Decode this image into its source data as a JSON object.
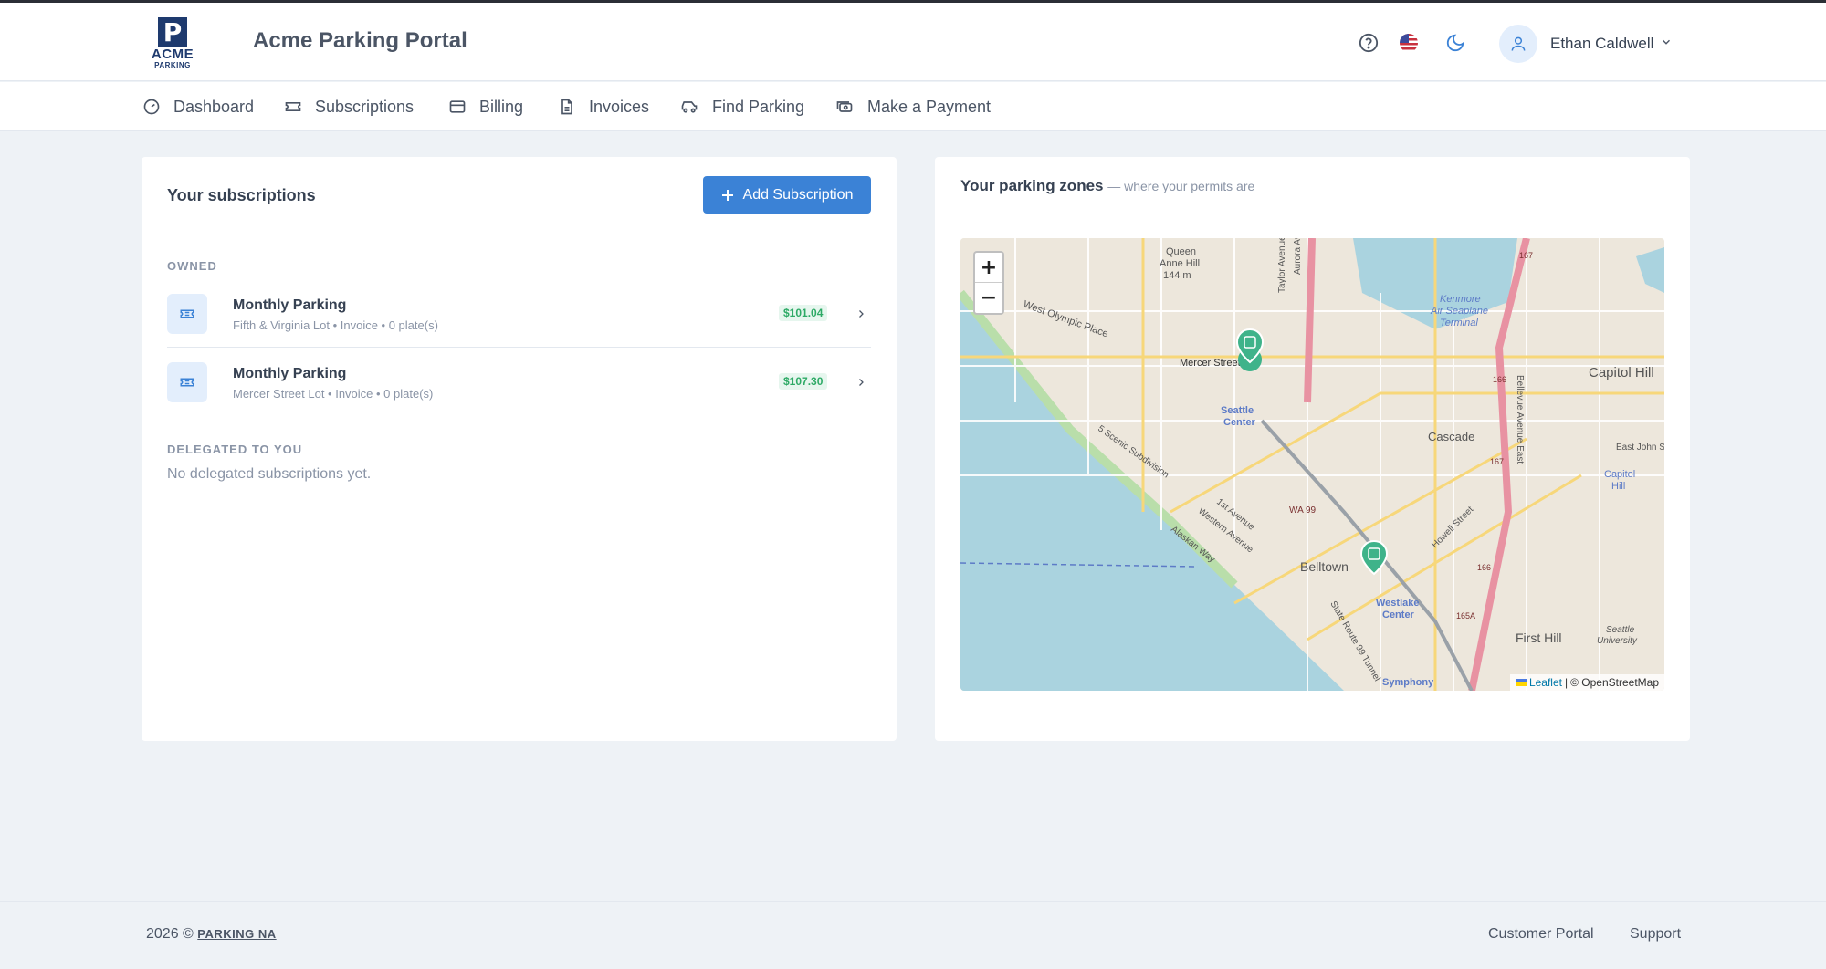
{
  "brand": {
    "logo_letter": "P",
    "logo_line1": "ACME",
    "logo_line2": "PARKING",
    "app_title": "Acme Parking Portal"
  },
  "header": {
    "icons": [
      "help-circle-icon",
      "us-flag-icon",
      "moon-icon"
    ],
    "user_name": "Ethan Caldwell"
  },
  "nav": {
    "items": [
      {
        "label": "Dashboard",
        "icon": "dashboard-icon"
      },
      {
        "label": "Subscriptions",
        "icon": "ticket-icon"
      },
      {
        "label": "Billing",
        "icon": "credit-card-icon"
      },
      {
        "label": "Invoices",
        "icon": "file-icon"
      },
      {
        "label": "Find Parking",
        "icon": "car-icon"
      },
      {
        "label": "Make a Payment",
        "icon": "cash-icon"
      }
    ]
  },
  "subscriptions": {
    "title": "Your subscriptions",
    "add_button": "Add Subscription",
    "owned_label": "OWNED",
    "owned": [
      {
        "name": "Monthly Parking",
        "meta": "Fifth & Virginia Lot • Invoice • 0 plate(s)",
        "price": "$101.04"
      },
      {
        "name": "Monthly Parking",
        "meta": "Mercer Street Lot • Invoice • 0 plate(s)",
        "price": "$107.30"
      }
    ],
    "delegated_label": "DELEGATED TO YOU",
    "delegated_empty": "No delegated subscriptions yet."
  },
  "zones": {
    "title": "Your parking zones",
    "subtitle": "— where your permits are",
    "map": {
      "zoom_in": "+",
      "zoom_out": "−",
      "attribution_leaflet": "Leaflet",
      "attribution_sep": "|",
      "attribution_osm": "© OpenStreetMap",
      "labels": [
        "Queen Anne Hill",
        "144 m",
        "West Olympic Place",
        "Mercer Street",
        "Seattle Center",
        "Cascade",
        "Capitol Hill",
        "East John St",
        "WA 99",
        "Belltown",
        "Westlake Center",
        "First Hill",
        "Seattle University",
        "Symphony",
        "Kenmore Air Seaplane Terminal",
        "Taylor Avenue",
        "Aurora Ave",
        "Western Avenue",
        "Alaskan Way",
        "1st Avenue",
        "Howell Street",
        "Bellevue Avenue East",
        "5 Scenic Subdivision",
        "State Route 99 Tunnel",
        "167",
        "166",
        "165A"
      ],
      "accent": "#3fb38a"
    }
  },
  "footer": {
    "copyright": "2026 ©",
    "company_link": "PARKING NA",
    "links": [
      "Customer Portal",
      "Support"
    ]
  },
  "colors": {
    "primary": "#3b82d6",
    "price_green": "#2eaa66",
    "background": "#eef2f6"
  }
}
